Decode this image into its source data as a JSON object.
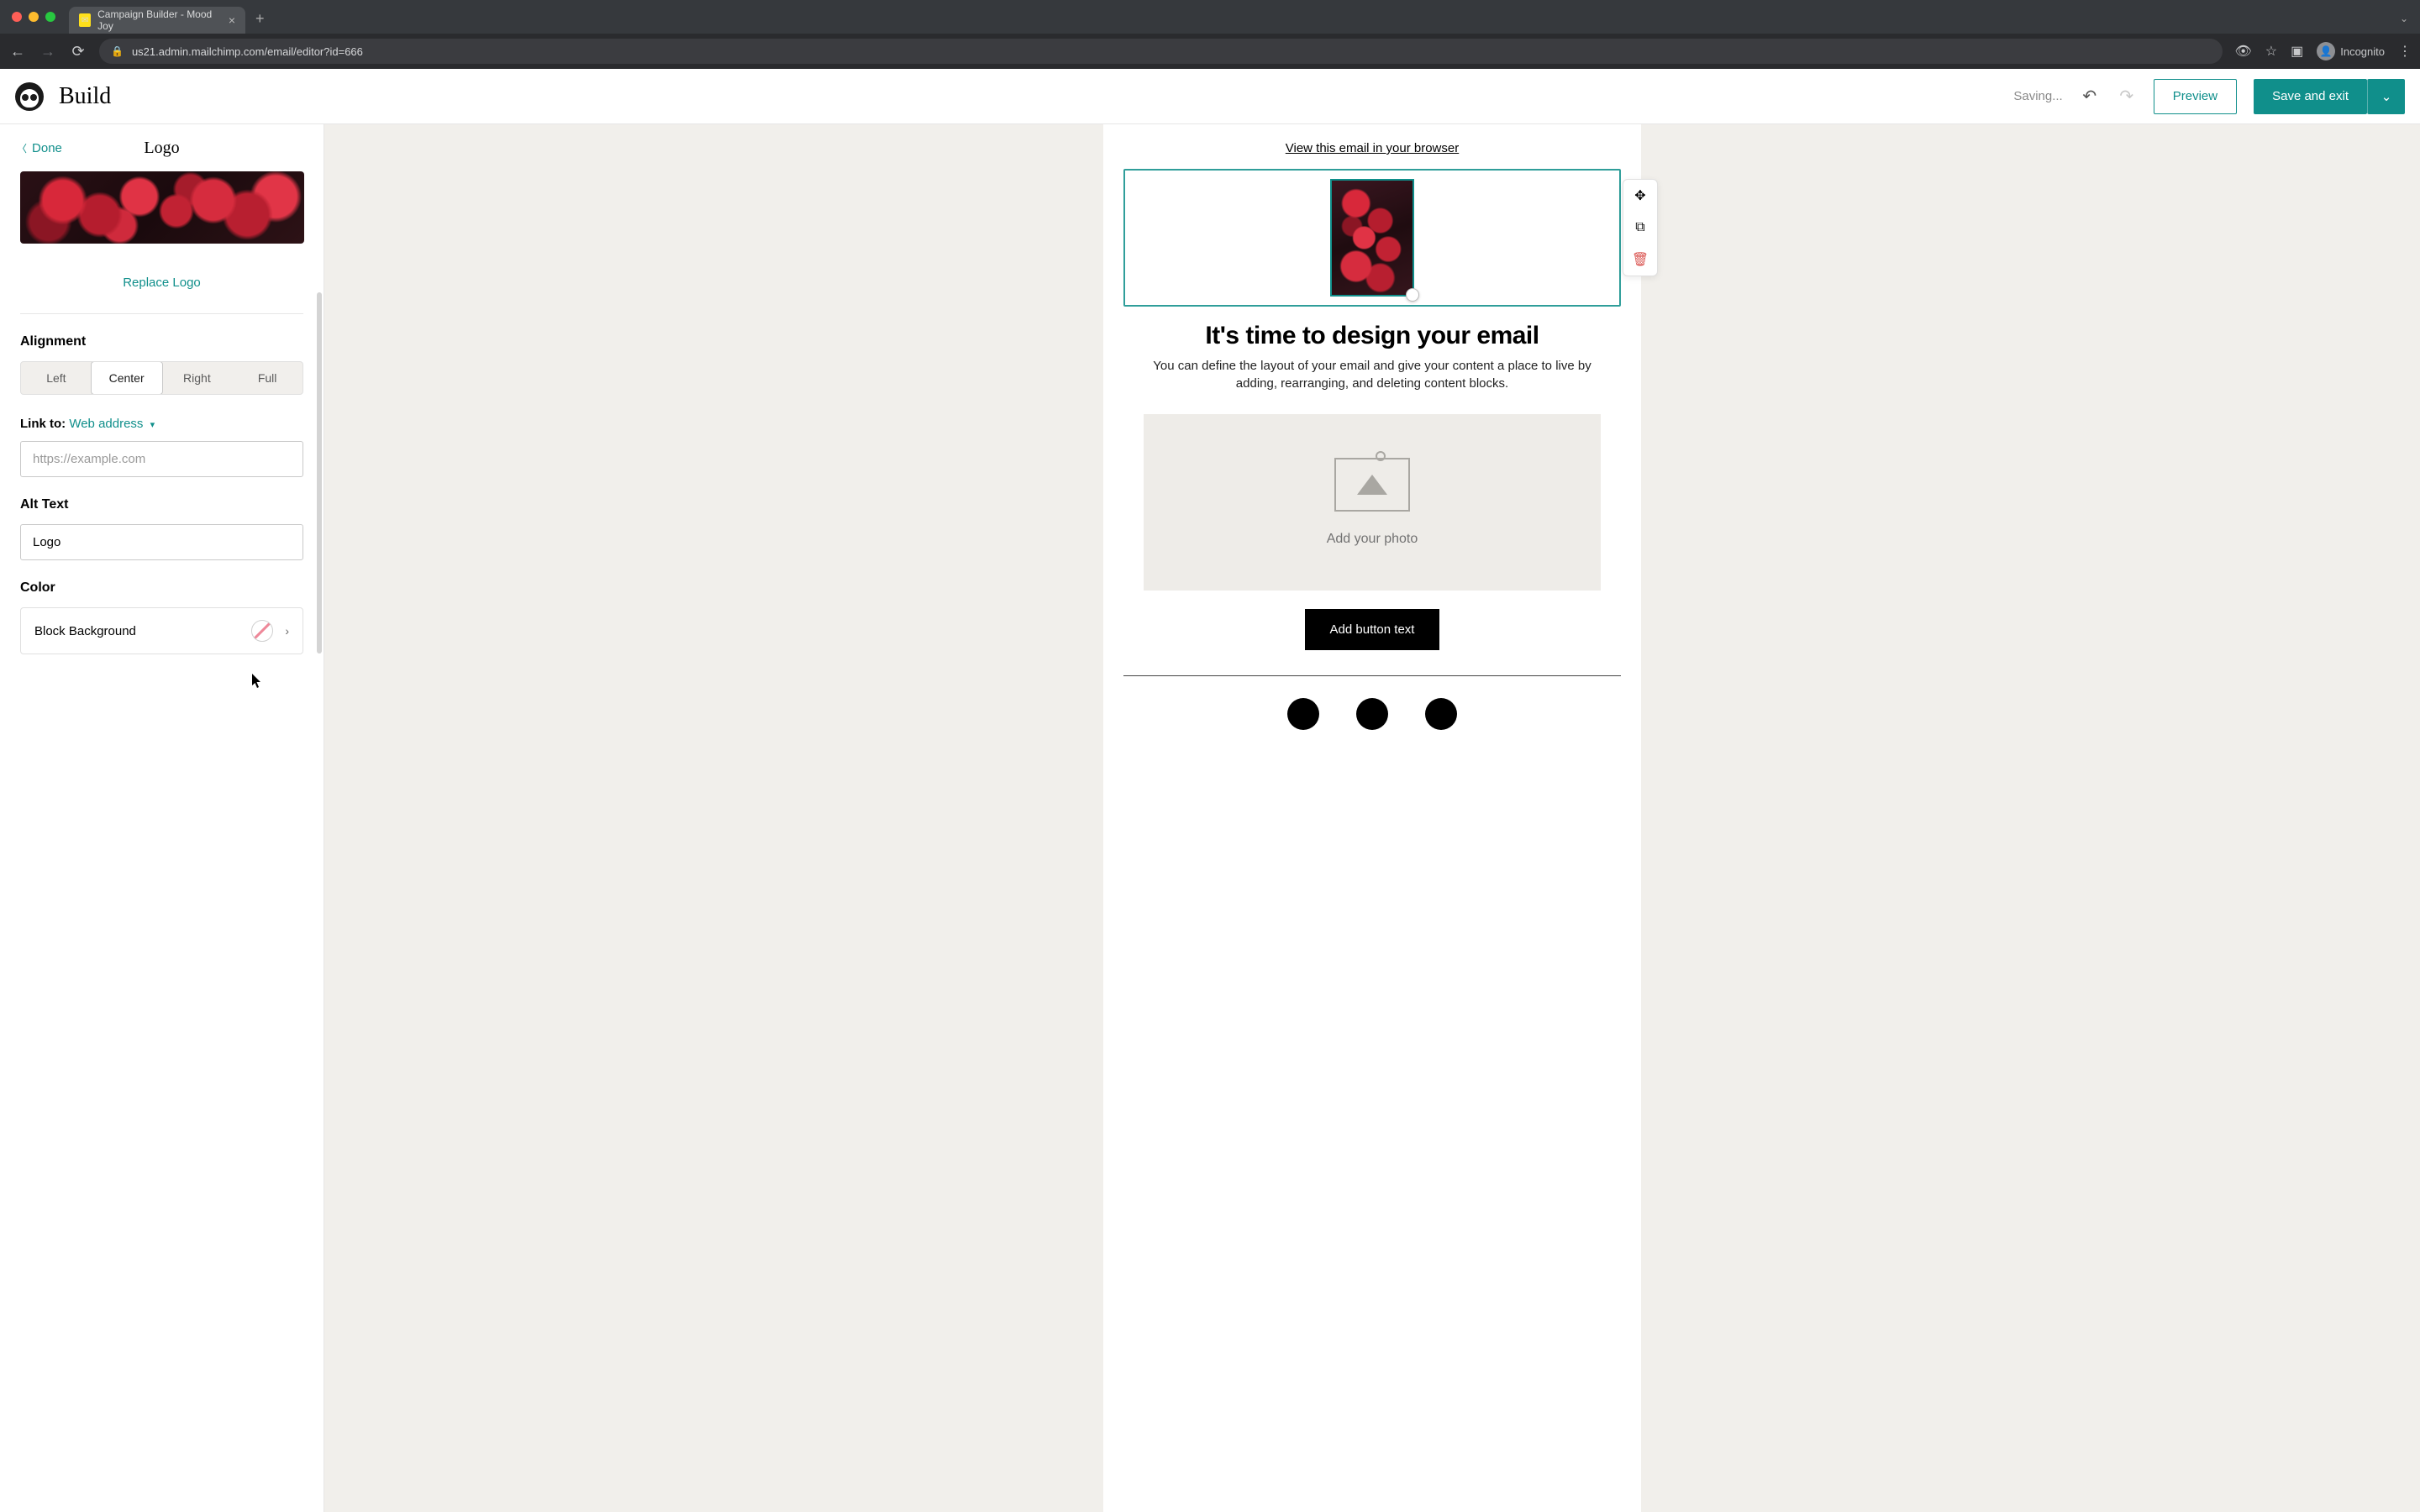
{
  "browser": {
    "tab_title": "Campaign Builder - Mood Joy",
    "url": "us21.admin.mailchimp.com/email/editor?id=666",
    "profile": "Incognito"
  },
  "appbar": {
    "title": "Build",
    "status": "Saving...",
    "preview": "Preview",
    "save": "Save and exit"
  },
  "panel": {
    "done": "Done",
    "title": "Logo",
    "replace": "Replace Logo",
    "alignment": {
      "label": "Alignment",
      "options": [
        "Left",
        "Center",
        "Right",
        "Full"
      ],
      "selected": "Center"
    },
    "linkto": {
      "label": "Link to:",
      "value": "Web address"
    },
    "url_placeholder": "https://example.com",
    "alt": {
      "label": "Alt Text",
      "value": "Logo"
    },
    "color": {
      "label": "Color",
      "option": "Block Background"
    }
  },
  "email": {
    "view_browser": "View this email in your browser",
    "headline": "It's time to design your email",
    "subhead": "You can define the layout of your email and give your content a place to live by adding, rearranging, and deleting content blocks.",
    "photo_placeholder": "Add your photo",
    "button": "Add button text"
  }
}
